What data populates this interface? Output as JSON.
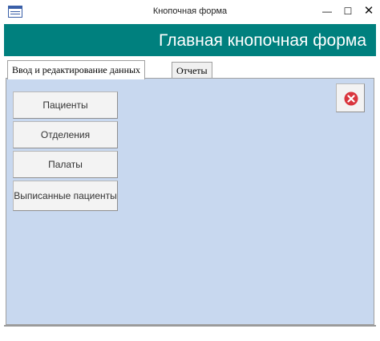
{
  "window": {
    "title": "Кнопочная форма",
    "controls": {
      "minimize": "—",
      "maximize": "☐",
      "close": "✕"
    }
  },
  "header": {
    "title": "Главная кнопочная форма",
    "background": "#00807e"
  },
  "tabs": [
    {
      "label": "Ввод и редактирование данных",
      "active": true
    },
    {
      "label": "Отчеты",
      "active": false
    }
  ],
  "panel": {
    "background": "#c8d8ef",
    "buttons": [
      {
        "label": "Пациенты"
      },
      {
        "label": "Отделения"
      },
      {
        "label": "Палаты"
      },
      {
        "label": "Выписанные пациенты"
      }
    ],
    "close_icon": {
      "name": "close-circle-icon",
      "color": "#d9363e"
    }
  }
}
